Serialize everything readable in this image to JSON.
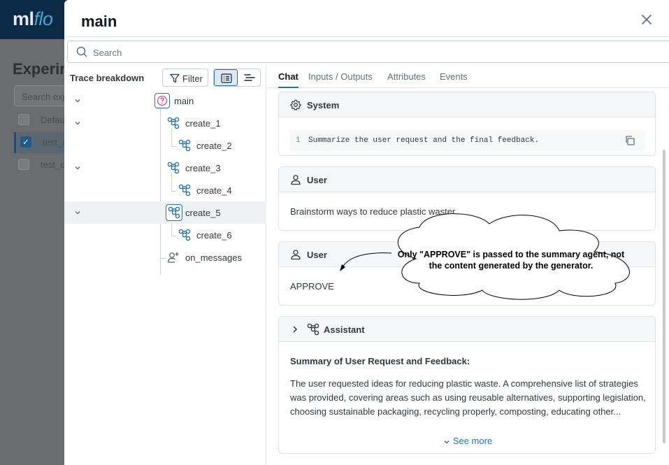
{
  "background": {
    "logo_main": "ml",
    "logo_accent": "flo",
    "title": "Experin",
    "search_placeholder": "Search exp",
    "rows": [
      {
        "label": "Defau",
        "checked": false
      },
      {
        "label": "test_a",
        "checked": true
      },
      {
        "label": "test_c",
        "checked": false
      }
    ]
  },
  "drawer": {
    "title": "main",
    "search_placeholder": "Search"
  },
  "left_panel": {
    "title": "Trace breakdown",
    "filter_label": "Filter",
    "view_modes": [
      "tree-view",
      "timeline-view"
    ],
    "active_view": "tree-view",
    "nodes": [
      {
        "label": "main",
        "icon": "question-icon",
        "expanded": true
      },
      {
        "label": "create_1",
        "icon": "agent-icon",
        "expanded": true
      },
      {
        "label": "create_2",
        "icon": "agent-icon"
      },
      {
        "label": "create_3",
        "icon": "agent-icon",
        "expanded": true
      },
      {
        "label": "create_4",
        "icon": "agent-icon"
      },
      {
        "label": "create_5",
        "icon": "agent-icon",
        "expanded": true,
        "selected": true
      },
      {
        "label": "create_6",
        "icon": "agent-icon"
      },
      {
        "label": "on_messages",
        "icon": "user-plus-icon"
      }
    ]
  },
  "right_panel": {
    "tabs": [
      "Chat",
      "Inputs / Outputs",
      "Attributes",
      "Events"
    ],
    "active_tab": "Chat",
    "messages": {
      "system": {
        "role": "System",
        "line_number": "1",
        "content": "Summarize the user request and the final feedback."
      },
      "user1": {
        "role": "User",
        "content": "Brainstorm ways to reduce plastic waster."
      },
      "user2": {
        "role": "User",
        "content": "APPROVE"
      },
      "assistant": {
        "role": "Assistant",
        "heading": "Summary of User Request and Feedback:",
        "line1": "The user requested ideas for reducing plastic waste. A comprehensive list of strategies",
        "line2": "was provided, covering areas such as using reusable alternatives, supporting legislation,",
        "line3": "choosing sustainable packaging, recycling properly, composting, educating other...",
        "see_more": "See more"
      }
    }
  },
  "annotation": {
    "line1": "Only \"APPROVE\" is passed to the summary agent, not",
    "line2": "the content generated by the generator."
  },
  "colors": {
    "accent": "#2272b4",
    "header_bg": "#0b2a45",
    "selected_row": "#eef2f5",
    "main_icon": "#e0457b"
  }
}
